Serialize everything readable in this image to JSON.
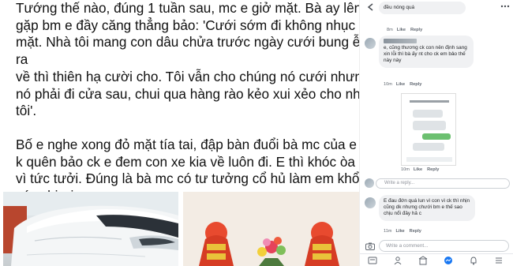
{
  "post": {
    "lines": [
      "Tướng thế nào, đúng 1 tuần sau, mc e giở mặt. Bà ay lên nhà",
      "gặp bm e đầy căng thẳng bảo: 'Cưới sớm đi không nhục",
      "mặt. Nhà tôi mang con dâu chửa trước ngày cưới  bung ễnh",
      "ra",
      "về thì thiên hạ cười cho. Tôi vẫn cho chúng nó cưới nhưng",
      "nó phải đi cửa sau, chui qua hàng rào kẻo xui xẻo cho nhà",
      "tôi'.",
      "Bố e nghe xong đỏ mặt tía tai, đập bàn đuổi bà mc của e về",
      "k quên bảo ck e đem con xe kia về luôn đi. E thì khóc òa lên",
      "vì tức tưởi. Đúng là bà mc có tư tưởng cổ hủ làm em khổ quá",
      "các chị ơi"
    ]
  },
  "phone": {
    "c1_text": "đều nóng quá",
    "c1_meta": {
      "time": "8m",
      "like": "Like",
      "reply": "Reply"
    },
    "c2_text": "e, cũng thương ck con nên định sang xin lỗi thì bà ấy nt cho ck em bảo thế này này",
    "c2_meta": {
      "time": "10m",
      "like": "Like",
      "reply": "Reply"
    },
    "c3_meta": {
      "time": "10m",
      "like": "Like",
      "reply": "Reply"
    },
    "reply_placeholder": "Write a reply...",
    "c4_text": "E đau đớn quá lun vì con vì ck thì nhịn cũng dk nhưng chưới bm e thế sao chịu nổi đây hả c",
    "c4_meta": {
      "time": "11m",
      "like": "Like",
      "reply": "Reply"
    },
    "comment_placeholder": "Write a comment..."
  },
  "colors": {
    "fb_blue": "#1877f2",
    "text": "#111111",
    "meta": "#606770"
  }
}
